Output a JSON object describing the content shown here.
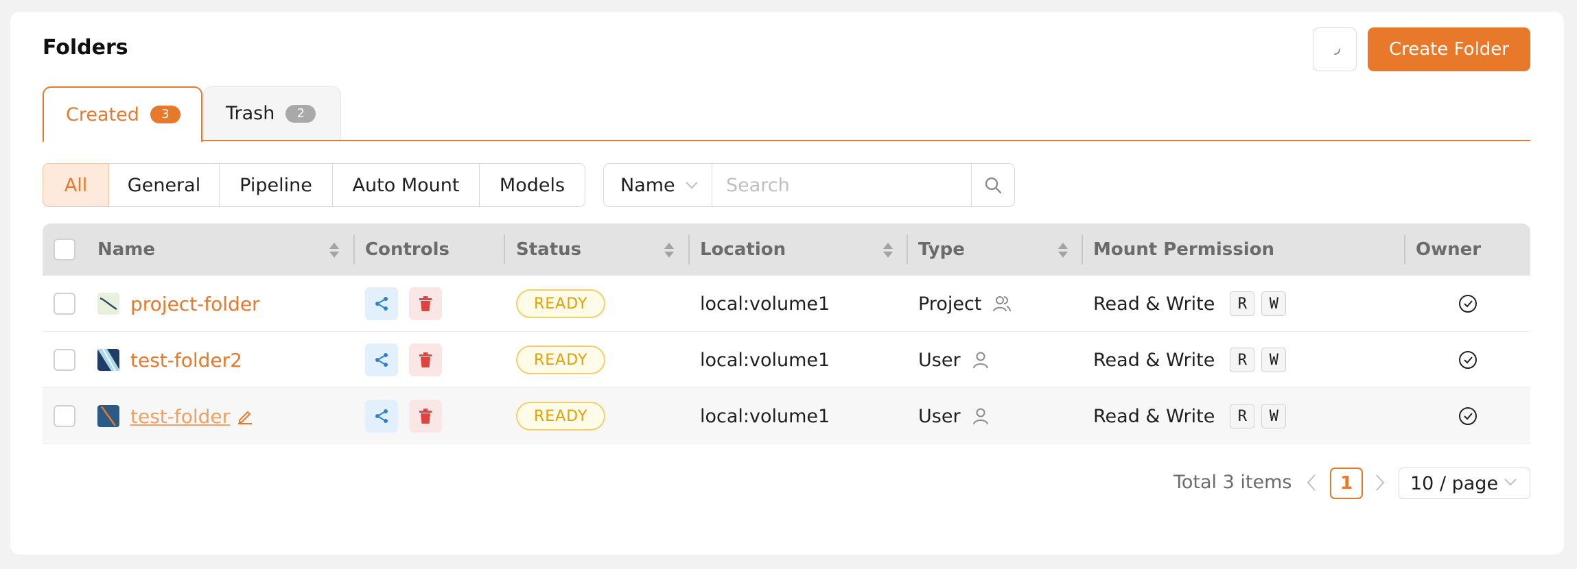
{
  "header": {
    "title": "Folders",
    "create_button": "Create Folder",
    "refresh_icon": "loading-spinner-icon"
  },
  "tabs": [
    {
      "label": "Created",
      "count": "3",
      "active": true
    },
    {
      "label": "Trash",
      "count": "2",
      "active": false
    }
  ],
  "filters": {
    "segments": [
      "All",
      "General",
      "Pipeline",
      "Auto Mount",
      "Models"
    ],
    "selected": "All"
  },
  "search": {
    "field_select": "Name",
    "placeholder": "Search",
    "value": ""
  },
  "table": {
    "columns": [
      "Name",
      "Controls",
      "Status",
      "Location",
      "Type",
      "Mount Permission",
      "Owner"
    ],
    "rows": [
      {
        "name": "project-folder",
        "status": "READY",
        "location": "local:volume1",
        "type": "Project",
        "type_icon": "group-user-icon",
        "permission": "Read & Write",
        "perm_keys": [
          "R",
          "W"
        ],
        "owner_icon": "check-circle-icon"
      },
      {
        "name": "test-folder2",
        "status": "READY",
        "location": "local:volume1",
        "type": "User",
        "type_icon": "user-icon",
        "permission": "Read & Write",
        "perm_keys": [
          "R",
          "W"
        ],
        "owner_icon": "check-circle-icon"
      },
      {
        "name": "test-folder",
        "status": "READY",
        "location": "local:volume1",
        "type": "User",
        "type_icon": "user-icon",
        "permission": "Read & Write",
        "perm_keys": [
          "R",
          "W"
        ],
        "owner_icon": "check-circle-icon",
        "editable": true
      }
    ]
  },
  "pagination": {
    "total": "Total 3 items",
    "current_page": "1",
    "page_size": "10 / page"
  },
  "colors": {
    "accent": "#e8792b",
    "status_ready": "#e3a100",
    "share_blue": "#2f7fd1",
    "delete_red": "#e0433f"
  }
}
